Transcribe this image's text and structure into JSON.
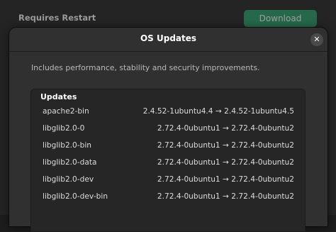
{
  "background": {
    "title": "Requires Restart",
    "download_label": "Download"
  },
  "dialog": {
    "title": "OS Updates",
    "close_glyph": "✕",
    "description": "Includes performance, stability and security improvements.",
    "section_title": "Updates",
    "packages": [
      {
        "name": "apache2-bin",
        "version": "2.4.52-1ubuntu4.4 → 2.4.52-1ubuntu4.5"
      },
      {
        "name": "libglib2.0-0",
        "version": "2.72.4-0ubuntu1 → 2.72.4-0ubuntu2"
      },
      {
        "name": "libglib2.0-bin",
        "version": "2.72.4-0ubuntu1 → 2.72.4-0ubuntu2"
      },
      {
        "name": "libglib2.0-data",
        "version": "2.72.4-0ubuntu1 → 2.72.4-0ubuntu2"
      },
      {
        "name": "libglib2.0-dev",
        "version": "2.72.4-0ubuntu1 → 2.72.4-0ubuntu2"
      },
      {
        "name": "libglib2.0-dev-bin",
        "version": "2.72.4-0ubuntu1 → 2.72.4-0ubuntu2"
      }
    ]
  },
  "colors": {
    "accent": "#26a269",
    "dialog_bg": "#303030",
    "card_bg": "#262626"
  }
}
